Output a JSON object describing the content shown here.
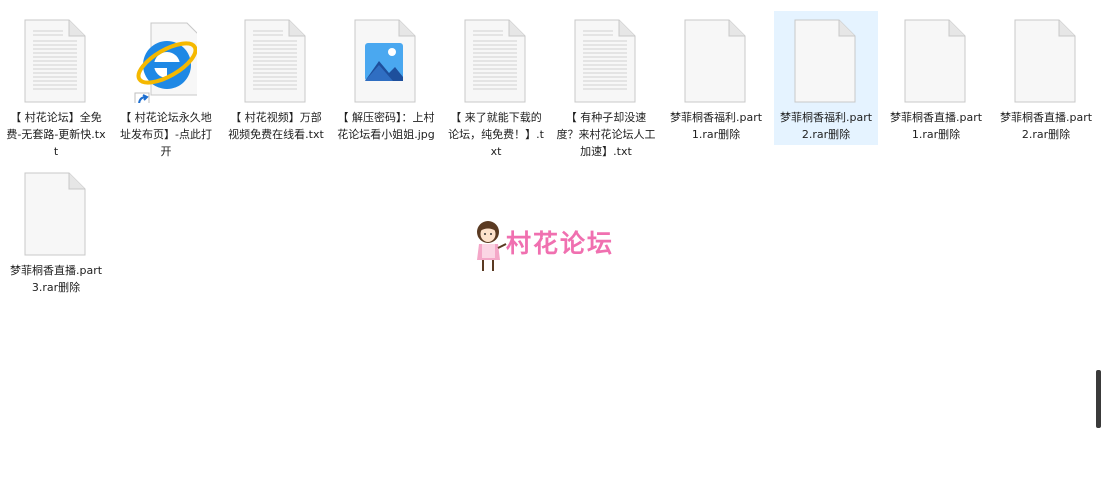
{
  "files": [
    {
      "name": "【 村花论坛】全免费-无套路-更新快.txt",
      "type": "text",
      "selected": false
    },
    {
      "name": "【 村花论坛永久地址发布页】-点此打开",
      "type": "shortcut",
      "selected": false
    },
    {
      "name": "【 村花视频】万部视频免费在线看.txt",
      "type": "text",
      "selected": false
    },
    {
      "name": "【 解压密码】：上村花论坛看小姐姐.jpg",
      "type": "image",
      "selected": false
    },
    {
      "name": "【 来了就能下载的论坛，纯免费！】.txt",
      "type": "text",
      "selected": false
    },
    {
      "name": "【 有种子却没速度？来村花论坛人工加速】.txt",
      "type": "text",
      "selected": false
    },
    {
      "name": "梦菲桐香福利.part1.rar删除",
      "type": "blank",
      "selected": false
    },
    {
      "name": "梦菲桐香福利.part2.rar删除",
      "type": "blank",
      "selected": true
    },
    {
      "name": "梦菲桐香直播.part1.rar删除",
      "type": "blank",
      "selected": false
    },
    {
      "name": "梦菲桐香直播.part2.rar删除",
      "type": "blank",
      "selected": false
    },
    {
      "name": "梦菲桐香直播.part3.rar删除",
      "type": "blank",
      "selected": false
    }
  ],
  "watermark": {
    "text": "村花论坛",
    "color": "#f070b0"
  },
  "colors": {
    "selection": "#e5f3ff",
    "page": "#ffffff",
    "ie_blue": "#1e88e5",
    "ie_ring": "#f5b800"
  }
}
